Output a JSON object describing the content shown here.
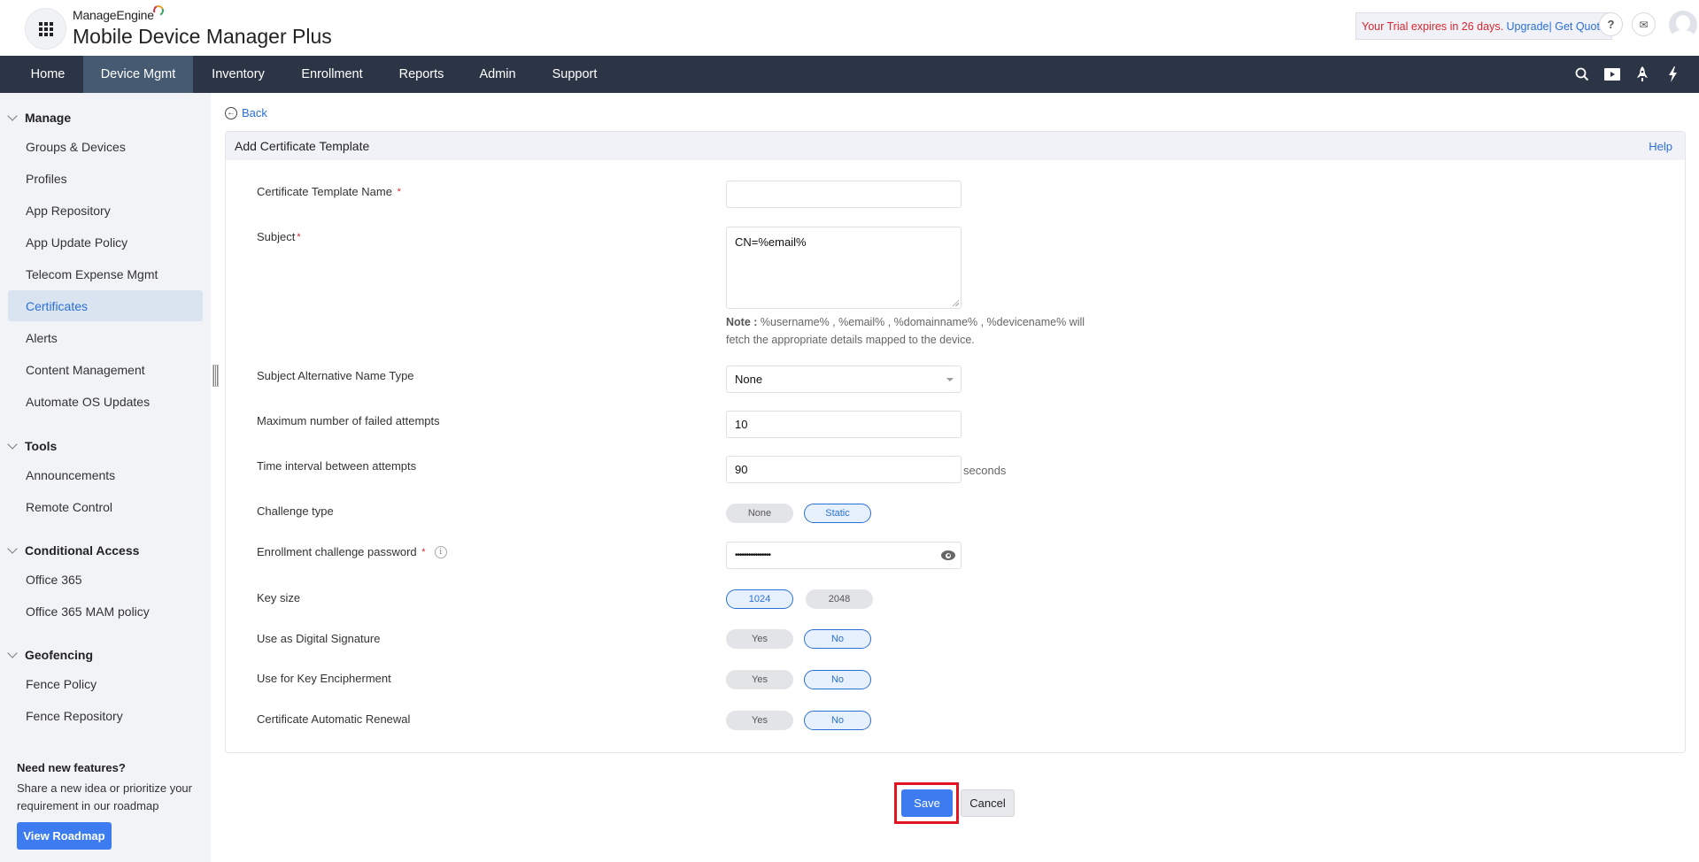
{
  "header": {
    "brand_small": "ManageEngine",
    "brand_big": "Mobile Device Manager Plus",
    "trial_text": "Your Trial expires in 26 days.",
    "upgrade_label": "Upgrade|",
    "quote_label": "Get Quote",
    "help_icon_glyph": "?",
    "mail_icon_glyph": "✉"
  },
  "nav": {
    "items": [
      {
        "label": "Home"
      },
      {
        "label": "Device Mgmt",
        "active": true
      },
      {
        "label": "Inventory"
      },
      {
        "label": "Enrollment"
      },
      {
        "label": "Reports"
      },
      {
        "label": "Admin"
      },
      {
        "label": "Support"
      }
    ],
    "icons": [
      "search-icon",
      "video-icon",
      "rocket-icon",
      "lightning-icon"
    ]
  },
  "sidebar": {
    "sections": [
      {
        "title": "Manage",
        "items": [
          "Groups & Devices",
          "Profiles",
          "App Repository",
          "App Update Policy",
          "Telecom Expense Mgmt",
          "Certificates",
          "Alerts",
          "Content Management",
          "Automate OS Updates"
        ]
      },
      {
        "title": "Tools",
        "items": [
          "Announcements",
          "Remote Control"
        ]
      },
      {
        "title": "Conditional Access",
        "items": [
          "Office 365",
          "Office 365 MAM policy"
        ]
      },
      {
        "title": "Geofencing",
        "items": [
          "Fence Policy",
          "Fence Repository"
        ]
      }
    ],
    "active_item": "Certificates",
    "promo": {
      "title": "Need new features?",
      "text": "Share a new idea or prioritize your requirement in our roadmap",
      "button": "View Roadmap"
    }
  },
  "page": {
    "back_label": "Back",
    "title": "Add Certificate Template",
    "help_label": "Help"
  },
  "form": {
    "template_name": {
      "label": "Certificate Template Name",
      "required": "*",
      "value": ""
    },
    "subject": {
      "label": "Subject",
      "required": "*",
      "value": "CN=%email%"
    },
    "note_bold": "Note :",
    "note_text": " %username% , %email% , %domainname% , %devicename% will fetch the appropriate details mapped to the device.",
    "san_type": {
      "label": "Subject Alternative Name Type",
      "value": "None"
    },
    "max_failed": {
      "label": "Maximum number of failed attempts",
      "value": "10"
    },
    "time_interval": {
      "label": "Time interval between attempts",
      "value": "90",
      "suffix": "seconds"
    },
    "challenge_type": {
      "label": "Challenge type",
      "options": [
        "None",
        "Static"
      ],
      "selected": "Static"
    },
    "challenge_password": {
      "label": "Enrollment challenge password",
      "required": "*",
      "value": "••••••••••••••••"
    },
    "key_size": {
      "label": "Key size",
      "options": [
        "1024",
        "2048"
      ],
      "selected": "1024"
    },
    "digital_signature": {
      "label": "Use as Digital Signature",
      "options": [
        "Yes",
        "No"
      ],
      "selected": "No"
    },
    "key_encipherment": {
      "label": "Use for Key Encipherment",
      "options": [
        "Yes",
        "No"
      ],
      "selected": "No"
    },
    "auto_renewal": {
      "label": "Certificate Automatic Renewal",
      "options": [
        "Yes",
        "No"
      ],
      "selected": "No"
    }
  },
  "actions": {
    "save": "Save",
    "cancel": "Cancel"
  },
  "colors": {
    "nav_bg": "#2c3545",
    "nav_active": "#465a71",
    "accent": "#2b6fd6",
    "primary_button": "#3d7cf0",
    "highlight_outline": "#e2141f",
    "trial_red": "#d9262f"
  }
}
